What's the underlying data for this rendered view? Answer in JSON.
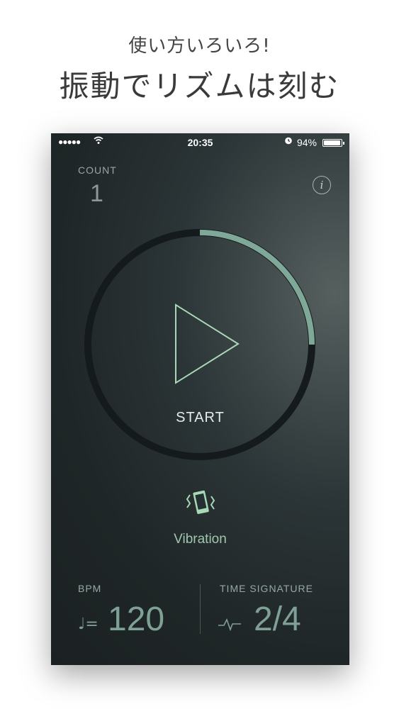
{
  "promo": {
    "subtitle": "使い方いろいろ!",
    "title": "振動でリズムは刻む"
  },
  "statusbar": {
    "signal": "●●●●●",
    "time": "20:35",
    "battery_pct": "94%",
    "battery_level": 0.94
  },
  "count": {
    "label": "COUNT",
    "value": "1"
  },
  "info": {
    "label": "i",
    "icon": "info-icon"
  },
  "player": {
    "start_label": "START",
    "progress": 0.25,
    "colors": {
      "ring": "#151b1c",
      "progress": "#7fa898",
      "play": "#a9d8b8"
    }
  },
  "vibration": {
    "label": "Vibration",
    "icon": "vibration-phone-icon"
  },
  "bpm": {
    "label": "BPM",
    "note": "♩=",
    "value": "120"
  },
  "time_signature": {
    "label": "TIME SIGNATURE",
    "value": "2/4",
    "icon": "pulse-icon"
  }
}
